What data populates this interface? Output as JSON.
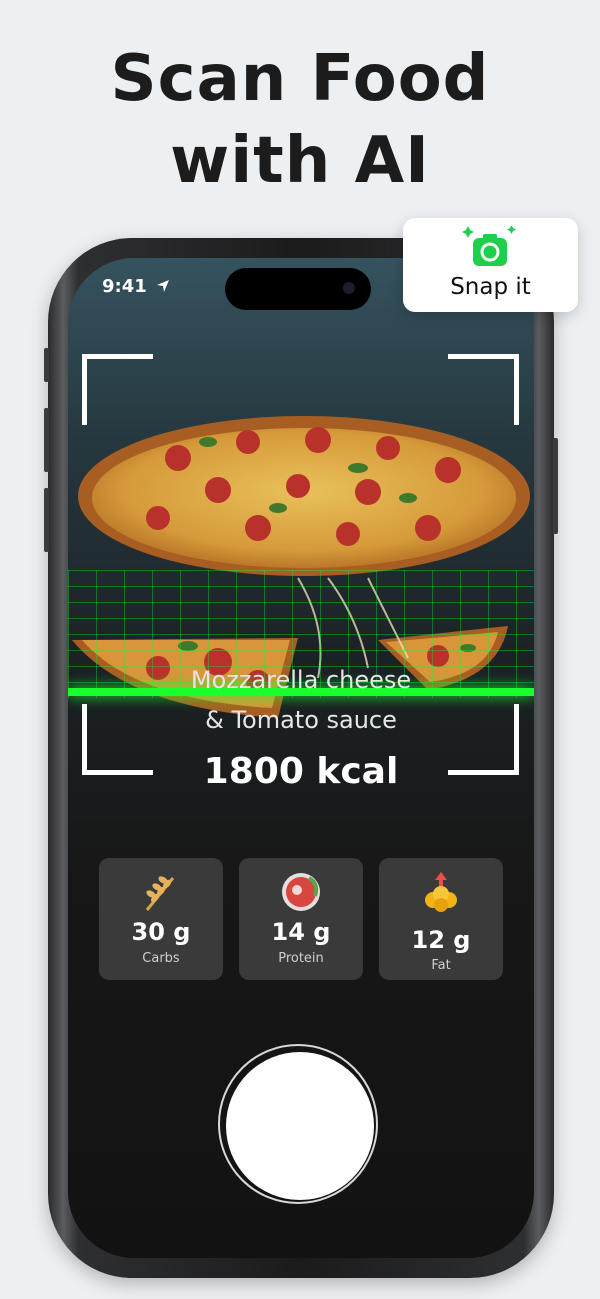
{
  "headline": {
    "line1": "Scan Food",
    "line2": "with AI"
  },
  "status_bar": {
    "time": "9:41"
  },
  "scan": {
    "food_name_line1": "Mozzarella cheese",
    "food_name_line2": "& Tomato sauce",
    "calories": "1800 kcal"
  },
  "macros": [
    {
      "value": "30 g",
      "label": "Carbs",
      "icon": "wheat-icon"
    },
    {
      "value": "14 g",
      "label": "Protein",
      "icon": "meat-icon"
    },
    {
      "value": "12 g",
      "label": "Fat",
      "icon": "fat-drops-icon"
    }
  ],
  "snap_card": {
    "label": "Snap it",
    "icon": "camera-icon"
  },
  "colors": {
    "scan_green": "#19ff2c",
    "background": "#edf0f3",
    "card_dark": "#3a3a3a"
  }
}
